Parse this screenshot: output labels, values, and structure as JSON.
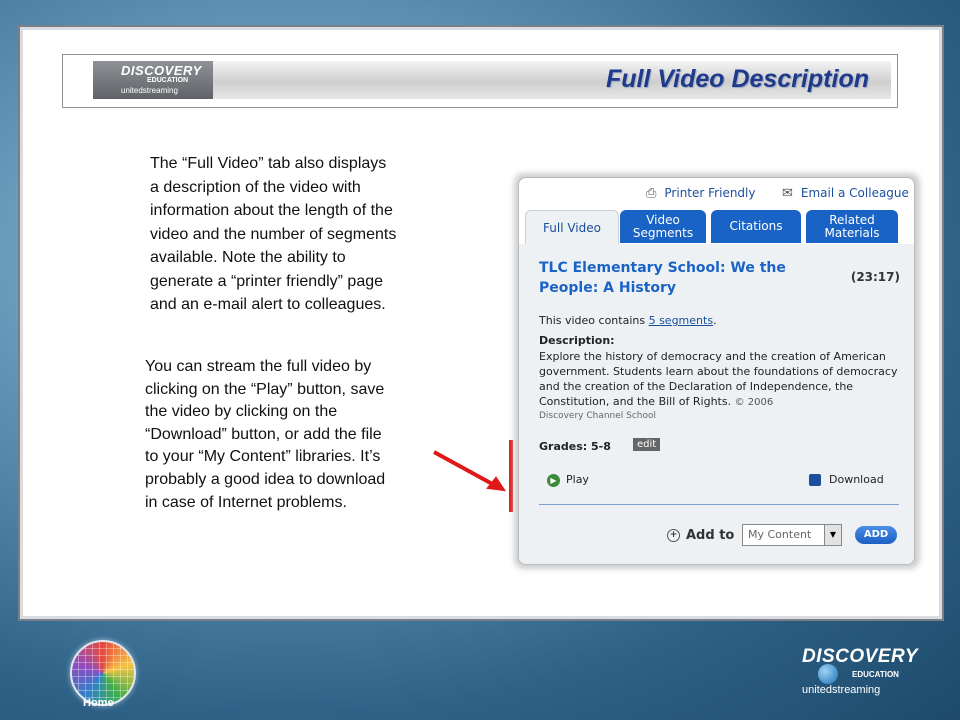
{
  "header": {
    "title": "Full Video Description",
    "logo": {
      "line1": "DISCOVERY",
      "line2": "EDUCATION",
      "line3": "unitedstreaming"
    }
  },
  "body_text": {
    "description_lines": [
      "The “Full Video” tab also displays",
      "a description of the video with",
      "information about the length of the",
      "video and the number of segments",
      "available. Note the ability to",
      "generate a “printer friendly” page",
      "and an e-mail alert to colleagues."
    ],
    "stream_lines": [
      "You can stream the full video by",
      "clicking on the “Play” button, save",
      "the video by clicking on the",
      "“Download” button, or add the file",
      "to your “My Content” libraries. It’s",
      "probably a good idea to download",
      "in case of Internet problems."
    ]
  },
  "widget": {
    "links": {
      "printer_friendly": "Printer Friendly",
      "email_colleague": "Email a Colleague"
    },
    "tabs": [
      {
        "line1": "Full Video",
        "line2": ""
      },
      {
        "line1": "Video",
        "line2": "Segments"
      },
      {
        "line1": "Citations",
        "line2": ""
      },
      {
        "line1": "Related",
        "line2": "Materials"
      }
    ],
    "video_title": "TLC Elementary School: We the People: A History",
    "duration": "(23:17)",
    "contains_prefix": "This video contains ",
    "segments_link": "5 segments",
    "contains_suffix": ".",
    "description_label": "Description:",
    "description": "Explore the history of democracy and the creation of American government. Students learn about the foundations of democracy and the creation of the Declaration of Independence, the Constitution, and the Bill of Rights.",
    "copyright": "© 2006",
    "source": "Discovery Channel School",
    "grades": "Grades: 5-8",
    "edit": "edit",
    "play": "Play",
    "download": "Download",
    "add_to": "Add to",
    "select_value": "My Content",
    "add_button": "ADD"
  },
  "footer": {
    "home_label": "Home",
    "logo": {
      "line1": "DISCOVERY",
      "line2": "EDUCATION",
      "line3": "unitedstreaming"
    }
  },
  "colors": {
    "title_blue": "#1f3a8a",
    "tab_blue": "#1a63c6",
    "arrow_red": "#e01818"
  }
}
